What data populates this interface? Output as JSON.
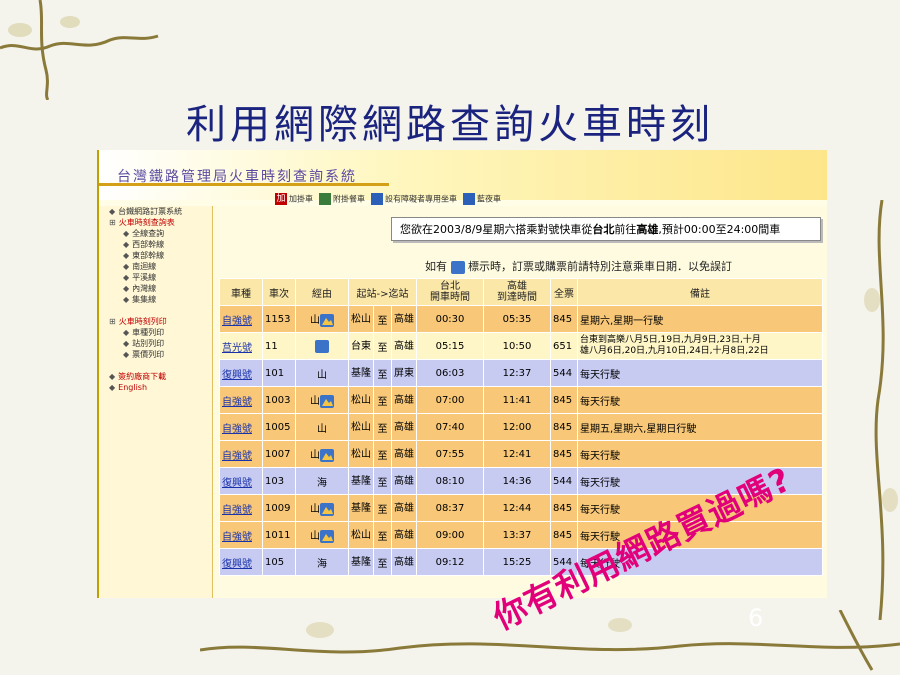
{
  "slide": {
    "title": "利用網際網路查詢火車時刻",
    "callout": "你有利用網路買過嗎?",
    "page_number": "6"
  },
  "site": {
    "title": "台灣鐵路管理局火車時刻查詢系統",
    "toolbar": [
      {
        "label": "加掛車",
        "icon": "add-icon",
        "mark": "加"
      },
      {
        "label": "附掛餐車",
        "icon": "dining-icon",
        "mark": ""
      },
      {
        "label": "設有障礙者專用坐車",
        "icon": "accessibility-icon",
        "mark": ""
      },
      {
        "label": "藍夜車",
        "icon": "night-train-icon",
        "mark": ""
      }
    ]
  },
  "sidebar": {
    "items": [
      {
        "label": "台鐵網路訂票系統",
        "level": 0,
        "marker": "◆",
        "red": false
      },
      {
        "label": "火車時刻查詢表",
        "level": 0,
        "marker": "⊞",
        "red": true
      },
      {
        "label": "全線查詢",
        "level": 1,
        "marker": "◆",
        "red": false
      },
      {
        "label": "西部幹線",
        "level": 1,
        "marker": "◆",
        "red": false
      },
      {
        "label": "東部幹線",
        "level": 1,
        "marker": "◆",
        "red": false
      },
      {
        "label": "南迴線",
        "level": 1,
        "marker": "◆",
        "red": false
      },
      {
        "label": "平溪線",
        "level": 1,
        "marker": "◆",
        "red": false
      },
      {
        "label": "內灣線",
        "level": 1,
        "marker": "◆",
        "red": false
      },
      {
        "label": "集集線",
        "level": 1,
        "marker": "◆",
        "red": false
      },
      {
        "label": "",
        "level": 0,
        "marker": "",
        "red": false
      },
      {
        "label": "火車時刻列印",
        "level": 0,
        "marker": "⊞",
        "red": true
      },
      {
        "label": "車種列印",
        "level": 1,
        "marker": "◆",
        "red": false
      },
      {
        "label": "站別列印",
        "level": 1,
        "marker": "◆",
        "red": false
      },
      {
        "label": "票價列印",
        "level": 1,
        "marker": "◆",
        "red": false
      },
      {
        "label": "",
        "level": 0,
        "marker": "",
        "red": false
      },
      {
        "label": "簽約廠商下載",
        "level": 0,
        "marker": "◆",
        "red": true
      },
      {
        "label": "English",
        "level": 0,
        "marker": "◆",
        "red": true
      }
    ]
  },
  "notice": {
    "prefix": "您欲在2003/8/9星期六搭乘對號快車從",
    "origin": "台北",
    "middle": "前往",
    "destination": "高雄",
    "suffix": ",預計00:00至24:00間車"
  },
  "note": {
    "before": "如有",
    "after": "標示時，訂票或購票前請特別注意乘車日期．以免誤訂"
  },
  "table": {
    "headers": {
      "type": "車種",
      "number": "車次",
      "via": "經由",
      "route": "起站->迄站",
      "dep_line1": "台北",
      "dep_line2": "開車時間",
      "arr_line1": "高雄",
      "arr_line2": "到達時間",
      "fare": "全票",
      "note": "備註"
    },
    "rows": [
      {
        "type": "自強號",
        "number": "1153",
        "via": "山",
        "via_icon": true,
        "from": "松山",
        "sep": "至",
        "to": "高雄",
        "dep": "00:30",
        "arr": "05:35",
        "fare": "845",
        "note": "星期六,星期一行駛",
        "note2": "",
        "style": "orange"
      },
      {
        "type": "莒光號",
        "number": "11",
        "via": "",
        "via_icon": "night",
        "from": "台東",
        "sep": "至",
        "to": "高雄",
        "dep": "05:15",
        "arr": "10:50",
        "fare": "651",
        "note": "台東到高樂八月5日,19日,九月9日,23日,十月",
        "note2": "雄八月6日,20日,九月10日,24日,十月8日,22日",
        "style": "cream"
      },
      {
        "type": "復興號",
        "number": "101",
        "via": "山",
        "via_icon": false,
        "from": "基隆",
        "sep": "至",
        "to": "屏東",
        "dep": "06:03",
        "arr": "12:37",
        "fare": "544",
        "note": "每天行駛",
        "note2": "",
        "style": "blue"
      },
      {
        "type": "自強號",
        "number": "1003",
        "via": "山",
        "via_icon": true,
        "from": "松山",
        "sep": "至",
        "to": "高雄",
        "dep": "07:00",
        "arr": "11:41",
        "fare": "845",
        "note": "每天行駛",
        "note2": "",
        "style": "orange"
      },
      {
        "type": "自強號",
        "number": "1005",
        "via": "山",
        "via_icon": false,
        "from": "松山",
        "sep": "至",
        "to": "高雄",
        "dep": "07:40",
        "arr": "12:00",
        "fare": "845",
        "note": "星期五,星期六,星期日行駛",
        "note2": "",
        "style": "orange"
      },
      {
        "type": "自強號",
        "number": "1007",
        "via": "山",
        "via_icon": true,
        "from": "松山",
        "sep": "至",
        "to": "高雄",
        "dep": "07:55",
        "arr": "12:41",
        "fare": "845",
        "note": "每天行駛",
        "note2": "",
        "style": "orange"
      },
      {
        "type": "復興號",
        "number": "103",
        "via": "海",
        "via_icon": false,
        "from": "基隆",
        "sep": "至",
        "to": "高雄",
        "dep": "08:10",
        "arr": "14:36",
        "fare": "544",
        "note": "每天行駛",
        "note2": "",
        "style": "blue"
      },
      {
        "type": "自強號",
        "number": "1009",
        "via": "山",
        "via_icon": true,
        "from": "基隆",
        "sep": "至",
        "to": "高雄",
        "dep": "08:37",
        "arr": "12:44",
        "fare": "845",
        "note": "每天行駛",
        "note2": "",
        "style": "orange"
      },
      {
        "type": "自強號",
        "number": "1011",
        "via": "山",
        "via_icon": true,
        "from": "松山",
        "sep": "至",
        "to": "高雄",
        "dep": "09:00",
        "arr": "13:37",
        "fare": "845",
        "note": "每天行駛",
        "note2": "",
        "style": "orange"
      },
      {
        "type": "復興號",
        "number": "105",
        "via": "海",
        "via_icon": false,
        "from": "基隆",
        "sep": "至",
        "to": "高雄",
        "dep": "09:12",
        "arr": "15:25",
        "fare": "544",
        "note": "每天行駛",
        "note2": "",
        "style": "blue"
      }
    ]
  },
  "colors": {
    "title": "#1a237e",
    "callout": "#e2007a",
    "row_orange": "#f8c878",
    "row_cream": "#fff6c8",
    "row_blue": "#c7cbf2",
    "link": "#1a33aa"
  }
}
